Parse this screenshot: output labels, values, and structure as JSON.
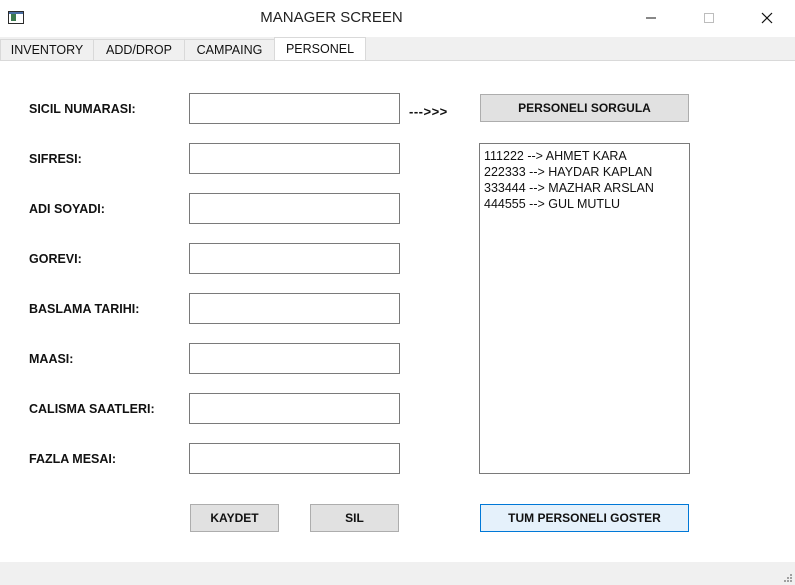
{
  "window": {
    "title": "MANAGER SCREEN"
  },
  "tabs": [
    {
      "label": "INVENTORY",
      "active": false
    },
    {
      "label": "ADD/DROP",
      "active": false
    },
    {
      "label": "CAMPAING",
      "active": false
    },
    {
      "label": "PERSONEL",
      "active": true
    }
  ],
  "form": {
    "fields": [
      {
        "label": "SICIL NUMARASI:",
        "value": ""
      },
      {
        "label": "SIFRESI:",
        "value": ""
      },
      {
        "label": "ADI SOYADI:",
        "value": ""
      },
      {
        "label": "GOREVI:",
        "value": ""
      },
      {
        "label": "BASLAMA TARIHI:",
        "value": ""
      },
      {
        "label": "MAASI:",
        "value": ""
      },
      {
        "label": "CALISMA SAATLERI:",
        "value": ""
      },
      {
        "label": "FAZLA MESAI:",
        "value": ""
      }
    ],
    "arrow_text": "--->>>",
    "query_button": "PERSONELI SORGULA",
    "save_button": "KAYDET",
    "delete_button": "SIL",
    "show_all_button": "TUM PERSONELI GOSTER"
  },
  "personnel_list": [
    "111222 --> AHMET KARA",
    "222333 --> HAYDAR KAPLAN",
    "333444 --> MAZHAR ARSLAN",
    "444555 --> GUL MUTLU"
  ],
  "colors": {
    "focus_border": "#0078d7",
    "focus_fill": "#e5f1fb"
  }
}
